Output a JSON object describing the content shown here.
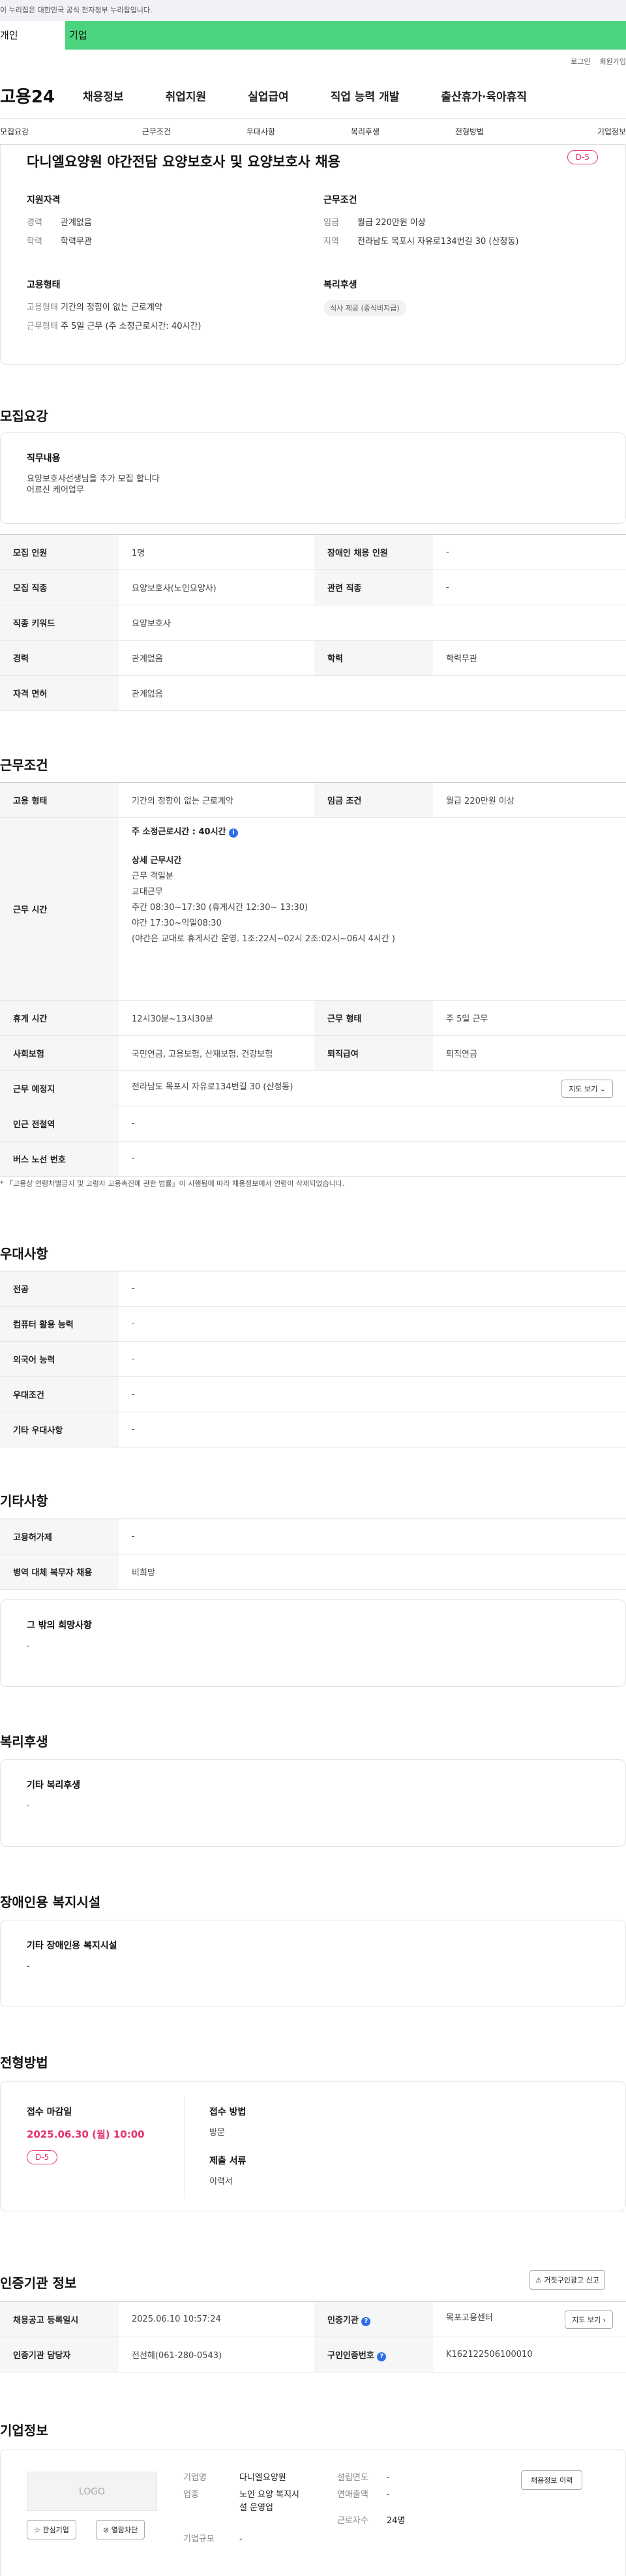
{
  "gov_banner": "이 누리집은 대한민국 공식 전자정부 누리집입니다.",
  "user_tabs": {
    "indiv": "개인",
    "corp": "기업"
  },
  "toplinks": [
    "로그인",
    "회원가입"
  ],
  "logo": "고용24",
  "gnb": [
    "채용정보",
    "취업지원",
    "실업급여",
    "직업 능력 개발",
    "출산휴가·육아휴직"
  ],
  "subtabs": [
    "모집요강",
    "근무조건",
    "우대사항",
    "복리후생",
    "전형방법",
    "기업정보"
  ],
  "job": {
    "title": "다니엘요양원 야간전담 요양보호사 및 요양보호사 채용",
    "dday": "D-5"
  },
  "summary": {
    "qual_title": "지원자격",
    "career_k": "경력",
    "career_v": "관계없음",
    "edu_k": "학력",
    "edu_v": "학력무관",
    "cond_title": "근무조건",
    "wage_k": "임금",
    "wage_v": "월급 220만원 이상",
    "loc_k": "지역",
    "loc_v": "전라남도 목포시 자유로134번길 30 (산정동)",
    "emp_title": "고용형태",
    "emptype_k": "고용형태",
    "emptype_v": "기간의 정함이 없는 근로계약",
    "worktype_k": "근무형태",
    "worktype_v": "주 5일 근무 (주 소정근로시간: 40시간)",
    "welfare_title": "복리후생",
    "welfare_tag": "식사 제공 (중식비지급)"
  },
  "recruit": {
    "title": "모집요강",
    "duty_title": "직무내용",
    "duty_l1": "요양보호사선생님을 추가 모집 합니다",
    "duty_l2": "어르신 케어업무",
    "r1": {
      "k1": "모집 인원",
      "v1": "1명",
      "k2": "장애인 채용 인원",
      "v2": "-"
    },
    "r2": {
      "k1": "모집 직종",
      "v1": "요양보호사(노인요양사)",
      "k2": "관련 직종",
      "v2": "-"
    },
    "r3": {
      "k1": "직종 키워드",
      "v1": "요양보호사"
    },
    "r4": {
      "k1": "경력",
      "v1": "관계없음",
      "k2": "학력",
      "v2": "학력무관"
    },
    "r5": {
      "k1": "자격 면허",
      "v1": "관계없음"
    }
  },
  "conditions": {
    "title": "근무조건",
    "r1": {
      "k1": "고용 형태",
      "v1": "기간의 정함이 없는 근로계약",
      "k2": "임금 조건",
      "v2": "월급 220만원 이상"
    },
    "hours_k": "근무 시간",
    "hours_main": "주 소정근로시간 : 40시간",
    "hours_lines": [
      "상세 근무시간",
      "근무 격일분",
      "교대근무",
      "주간 08:30~17:30 (휴게시간 12:30~ 13:30)",
      "야간 17:30~익일08:30",
      "(야간은 교대로 휴게시간 운영. 1조:22시~02시 2조:02시~06시  4시간 )"
    ],
    "r3": {
      "k1": "휴게 시간",
      "v1": "12시30분~13시30분",
      "k2": "근무 형태",
      "v2": "주 5일 근무"
    },
    "r4": {
      "k1": "사회보험",
      "v1": "국민연금, 고용보험, 산재보험, 건강보험",
      "k2": "퇴직급여",
      "v2": "퇴직연금"
    },
    "r5": {
      "k1": "근무 예정지",
      "v1": "전라남도 목포시 자유로134번길 30 (산정동)",
      "btn": "지도 보기"
    },
    "r6": {
      "k1": "인근 전철역",
      "v1": "-"
    },
    "r7": {
      "k1": "버스 노선 번호",
      "v1": "-"
    },
    "note": "「고용상 연령차별금지 및 고령자 고용촉진에 관한 법률」이 시행됨에 따라 채용정보에서 연령이 삭제되었습니다."
  },
  "preference": {
    "title": "우대사항",
    "rows": [
      {
        "k": "전공",
        "v": "-"
      },
      {
        "k": "컴퓨터 활용 능력",
        "v": "-"
      },
      {
        "k": "외국어 능력",
        "v": "-"
      },
      {
        "k": "우대조건",
        "v": "-"
      },
      {
        "k": "기타 우대사항",
        "v": "-"
      }
    ]
  },
  "etc": {
    "title": "기타사항",
    "rows": [
      {
        "k": "고용허가제",
        "v": "-"
      },
      {
        "k": "병역 대체 복무자 채용",
        "v": "비희망"
      }
    ],
    "wish_title": "그 밖의 희망사항",
    "wish_v": "-"
  },
  "welfare": {
    "title": "복리후생",
    "box_title": "기타 복리후생",
    "box_v": "-"
  },
  "disabled": {
    "title": "장애인용 복지시설",
    "box_title": "기타 장애인용 복지시설",
    "box_v": "-"
  },
  "selection": {
    "title": "전형방법",
    "deadline_k": "접수 마감일",
    "deadline_v": "2025.06.30 (월) 10:00",
    "dday": "D-5",
    "method_k": "접수 방법",
    "method_v": "방문",
    "docs_k": "제출 서류",
    "docs_v": "이력서"
  },
  "cert": {
    "title": "인증기관 정보",
    "report_btn": "거짓구인광고 신고",
    "r1": {
      "k1": "채용공고 등록일시",
      "v1": "2025.06.10 10:57:24",
      "k2": "인증기관",
      "v2": "목포고용센터",
      "btn": "지도 보기"
    },
    "r2": {
      "k1": "인증기관 담당자",
      "v1": "전선혜(061-280-0543)",
      "k2": "구인인증번호",
      "v2": "K162122506100010"
    }
  },
  "company": {
    "title": "기업정보",
    "logo": "LOGO",
    "fav_btn": "관심기업",
    "block_btn": "열람차단",
    "name_k": "기업명",
    "name_v": "다니엘요양원",
    "year_k": "설립연도",
    "year_v": "-",
    "history_btn": "채용정보 이력",
    "biz_k": "업종",
    "biz_v1": "노인 요양 복지시",
    "biz_v2": "설 운영업",
    "sales_k": "연매출액",
    "sales_v": "-",
    "emp_k": "근로자수",
    "emp_v": "24명",
    "size_k": "기업규모",
    "size_v": "-"
  }
}
